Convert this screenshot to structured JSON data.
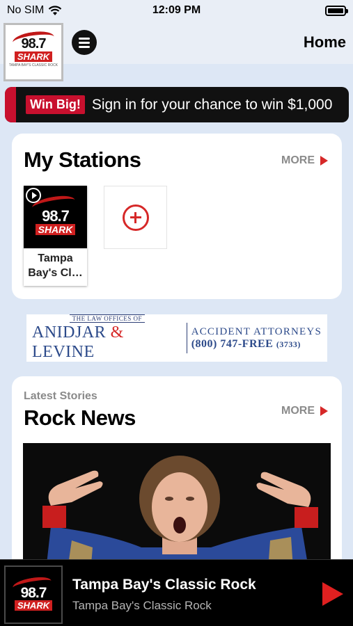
{
  "status_bar": {
    "carrier": "No SIM",
    "time": "12:09 PM",
    "battery_level": 1.0
  },
  "header": {
    "logo": {
      "number": "98.7",
      "name": "SHARK",
      "tagline": "TAMPA BAY'S CLASSIC ROCK"
    },
    "menu_icon": "hamburger-menu-icon",
    "title": "Home"
  },
  "promo_banner": {
    "badge": "Win Big!",
    "text": "Sign in for your chance to win $1,000",
    "accent_color": "#c8102e"
  },
  "my_stations": {
    "title": "My Stations",
    "more_label": "MORE",
    "stations": [
      {
        "logo_number": "98.7",
        "logo_name": "SHARK",
        "name": "Tampa Bay's Cl…"
      }
    ],
    "add_icon": "plus-circle-icon"
  },
  "ad": {
    "top_line": "THE LAW OFFICES OF",
    "firm_part1": "ANIDJAR",
    "firm_amp": "&",
    "firm_part2": "LEVINE",
    "title": "ACCIDENT ATTORNEYS",
    "phone": "(800) 747-FREE",
    "phone_digits": "(3733)"
  },
  "latest_stories": {
    "label": "Latest Stories",
    "title": "Rock News",
    "more_label": "MORE"
  },
  "player": {
    "logo_number": "98.7",
    "logo_name": "SHARK",
    "title": "Tampa Bay's Classic Rock",
    "subtitle": "Tampa Bay's Classic Rock",
    "play_color": "#e02020"
  }
}
